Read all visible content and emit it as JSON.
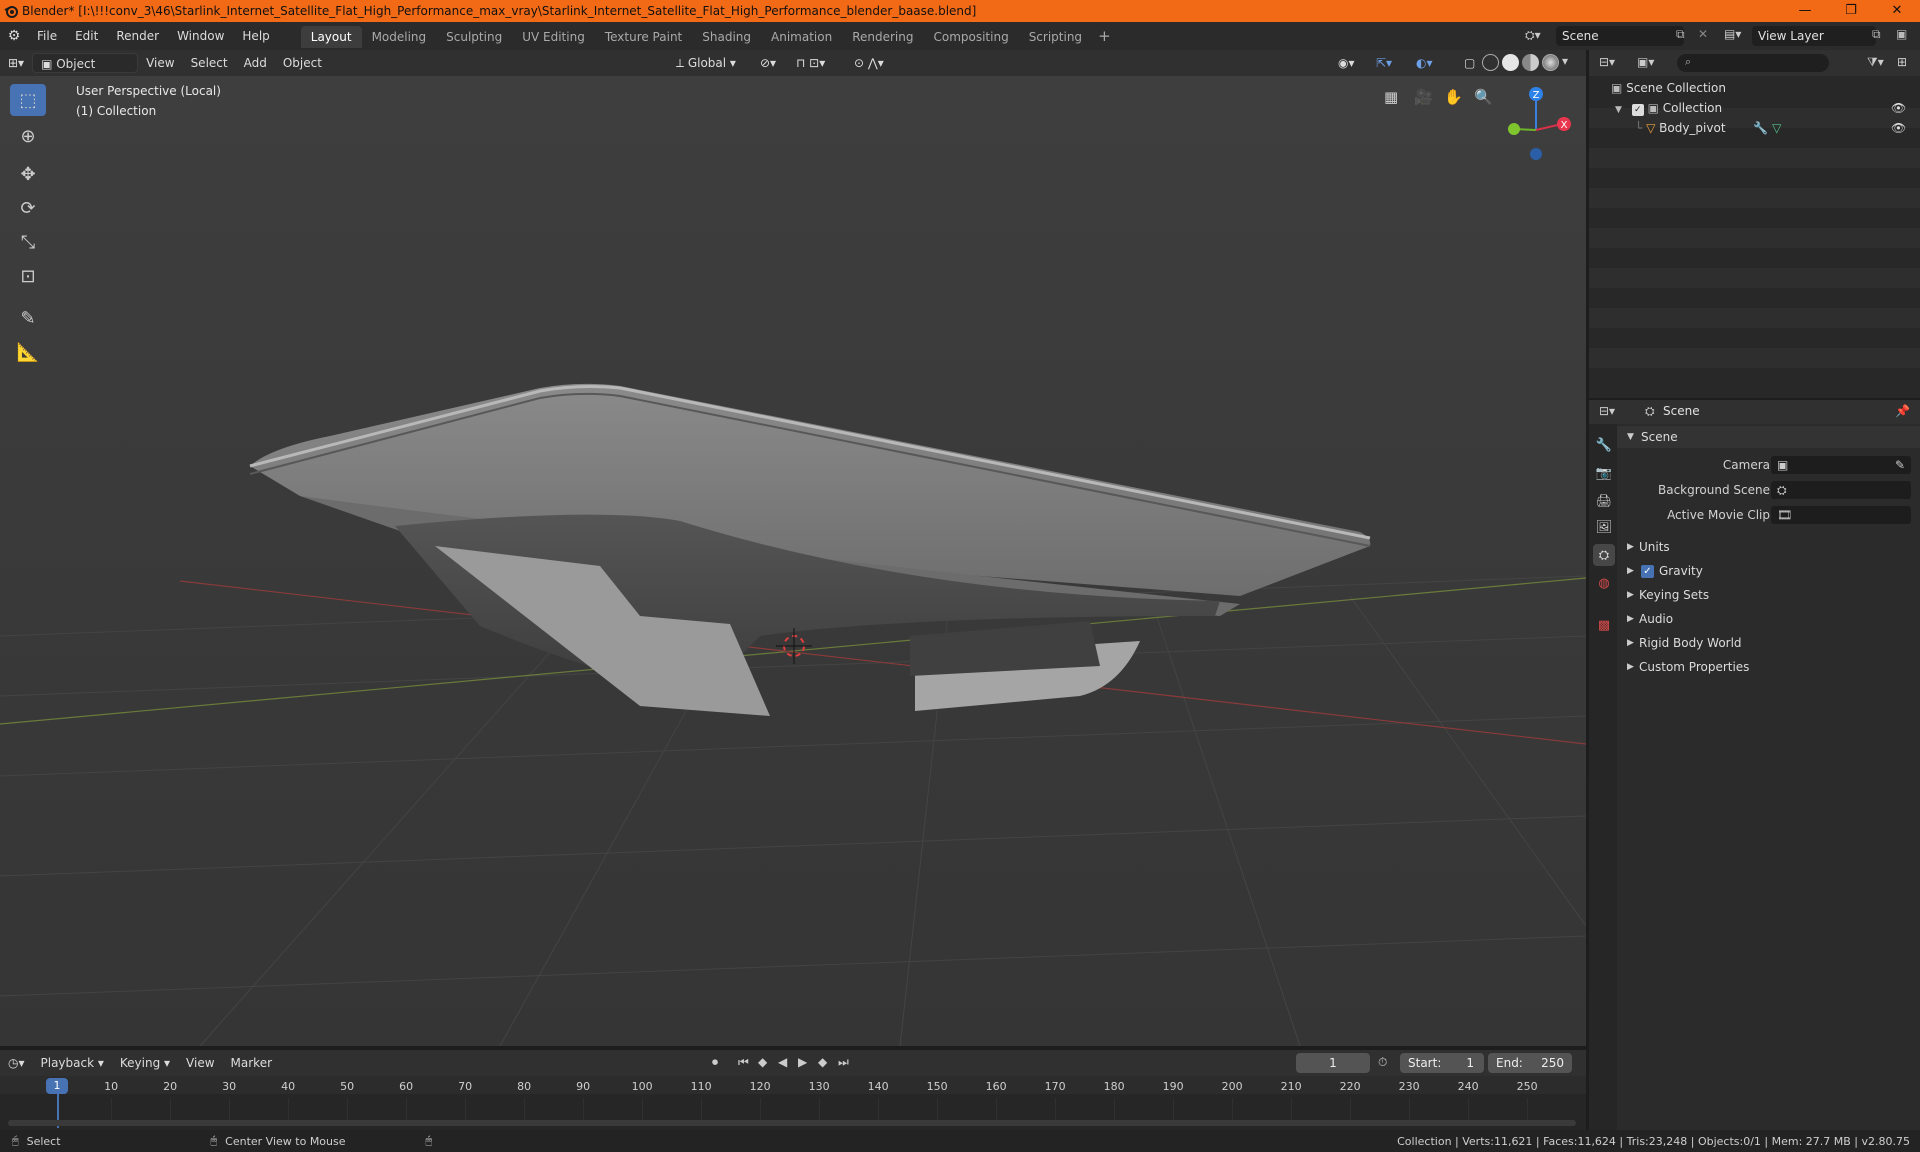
{
  "window": {
    "title": "Blender* [I:\\!!!conv_3\\46\\Starlink_Internet_Satellite_Flat_High_Performance_max_vray\\Starlink_Internet_Satellite_Flat_High_Performance_blender_baase.blend]",
    "controls": [
      "—",
      "❐",
      "✕"
    ]
  },
  "menu": [
    "File",
    "Edit",
    "Render",
    "Window",
    "Help"
  ],
  "workspaces": [
    "Layout",
    "Modeling",
    "Sculpting",
    "UV Editing",
    "Texture Paint",
    "Shading",
    "Animation",
    "Rendering",
    "Compositing",
    "Scripting"
  ],
  "active_workspace": "Layout",
  "scene_name": "Scene",
  "view_layer": "View Layer",
  "viewport": {
    "mode": "Object Mode",
    "menus": [
      "View",
      "Select",
      "Add",
      "Object"
    ],
    "transform_orientation": "Global",
    "info_line1": "User Perspective (Local)",
    "info_line2": "(1) Collection",
    "gizmo_axes": {
      "z": "Z",
      "y": "Y",
      "x": "X"
    },
    "tools": [
      "select-box-icon",
      "cursor-icon",
      "move-icon",
      "rotate-icon",
      "scale-icon",
      "transform-icon",
      "annotate-icon",
      "measure-icon"
    ]
  },
  "outliner": {
    "search_placeholder": "",
    "scene_collection": "Scene Collection",
    "collection": "Collection",
    "object": "Body_pivot"
  },
  "properties": {
    "breadcrumb": "Scene",
    "panel_title": "Scene",
    "camera_label": "Camera",
    "bg_scene_label": "Background Scene",
    "movie_clip_label": "Active Movie Clip",
    "sections": [
      "Units",
      "Gravity",
      "Keying Sets",
      "Audio",
      "Rigid Body World",
      "Custom Properties"
    ],
    "gravity_checked": true
  },
  "timeline": {
    "menus": [
      "Playback",
      "Keying",
      "View",
      "Marker"
    ],
    "current_frame": "1",
    "start_label": "Start:",
    "start": "1",
    "end_label": "End:",
    "end": "250",
    "ticks": [
      "1",
      "10",
      "20",
      "30",
      "40",
      "50",
      "60",
      "70",
      "80",
      "90",
      "100",
      "110",
      "120",
      "130",
      "140",
      "150",
      "160",
      "170",
      "180",
      "190",
      "200",
      "210",
      "220",
      "230",
      "240",
      "250"
    ]
  },
  "status": {
    "left1": "Select",
    "left2": "Center View to Mouse",
    "right": "Collection | Verts:11,621 | Faces:11,624 | Tris:23,248 | Objects:0/1 | Mem: 27.7 MB | v2.80.75"
  },
  "colors": {
    "titlebar": "#f36a16",
    "active_tool": "#4772b3",
    "x_axis": "#e8364f",
    "y_axis": "#7fc62e",
    "z_axis": "#2f83e8"
  }
}
